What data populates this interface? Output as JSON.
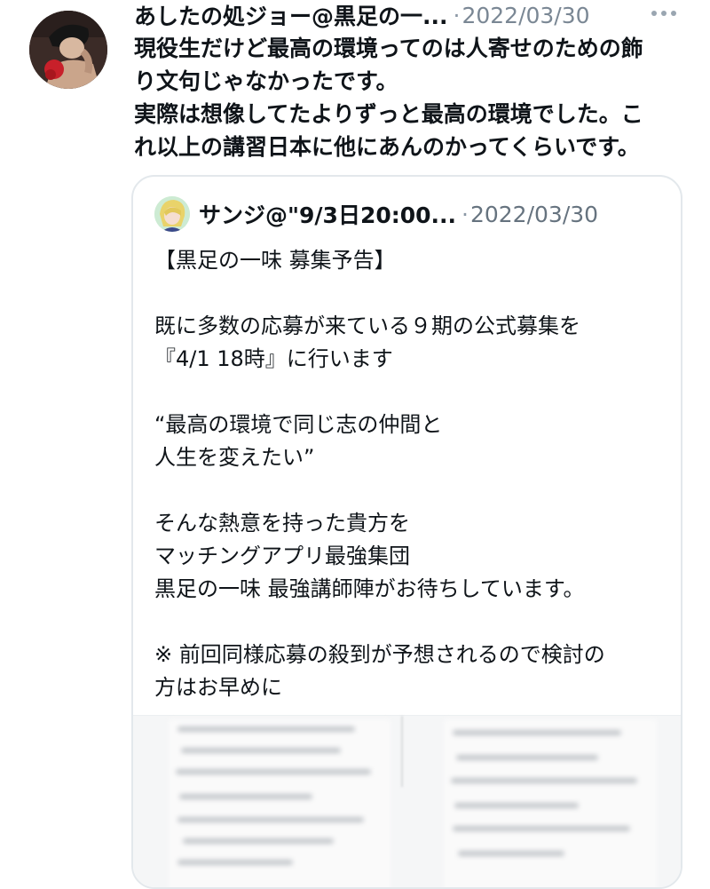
{
  "tweet": {
    "author_name": "あしたの処ジョー@黒足の一...",
    "separator": "·",
    "timestamp": "2022/03/30",
    "text_lines": [
      "現役生だけど最高の環境ってのは人寄せのための飾",
      "り文句じゃなかったです。",
      "実際は想像してたよりずっと最高の環境でした。こ",
      "れ以上の講習日本に他にあんのかってくらいです。"
    ]
  },
  "quoted_tweet": {
    "author_name": "サンジ@\"9/3日20:00...",
    "separator": "·",
    "timestamp": "2022/03/30",
    "text_lines": [
      "【黒足の一味 募集予告】",
      "",
      "既に多数の応募が来ている９期の公式募集を",
      "『4/1 18時』に行います",
      "",
      "“最高の環境で同じ志の仲間と",
      "人生を変えたい”",
      "",
      "そんな熱意を持った貴方を",
      "マッチングアプリ最強集団",
      "黒足の一味 最強講師陣がお待ちしています。",
      "",
      "※ 前回同様応募の殺到が予想されるので検討の",
      "方はお早めに"
    ]
  },
  "icons": {
    "more": "more-options-icon",
    "avatar": "boxer-avatar",
    "quoted_avatar": "character-avatar"
  },
  "colors": {
    "text": "#0f1419",
    "secondary_text": "#7a8794",
    "border": "#e3e8ec"
  }
}
